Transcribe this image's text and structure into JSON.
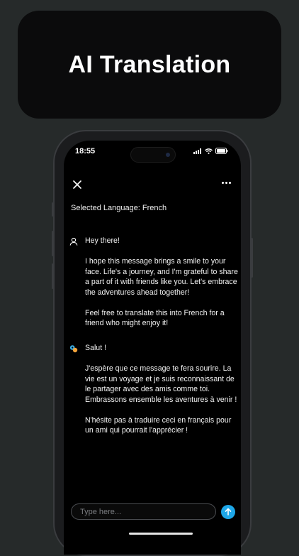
{
  "banner": {
    "title": "AI Translation"
  },
  "status_bar": {
    "time": "18:55"
  },
  "header": {
    "selected_language": "Selected Language: French"
  },
  "messages": [
    {
      "role": "user",
      "icon": "user-icon",
      "paragraphs": [
        "Hey there!",
        "I hope this message brings a smile to your face. Life's a journey, and I'm grateful to share a part of it with friends like you. Let's embrace the adventures ahead together!",
        "Feel free to translate this into French for a friend who might enjoy it!"
      ]
    },
    {
      "role": "assistant",
      "icon": "ai-assistant-icon",
      "paragraphs": [
        "Salut !",
        "J'espère que ce message te fera sourire. La vie est un voyage et je suis reconnaissant de le partager avec des amis comme toi. Embrassons ensemble les aventures à venir !",
        "N'hésite pas à traduire ceci en français pour un ami qui pourrait l'apprécier !"
      ]
    }
  ],
  "composer": {
    "placeholder": "Type here...",
    "value": ""
  },
  "colors": {
    "background": "#262a2a",
    "send_button": "#1ea7e8",
    "screen": "#000000"
  }
}
